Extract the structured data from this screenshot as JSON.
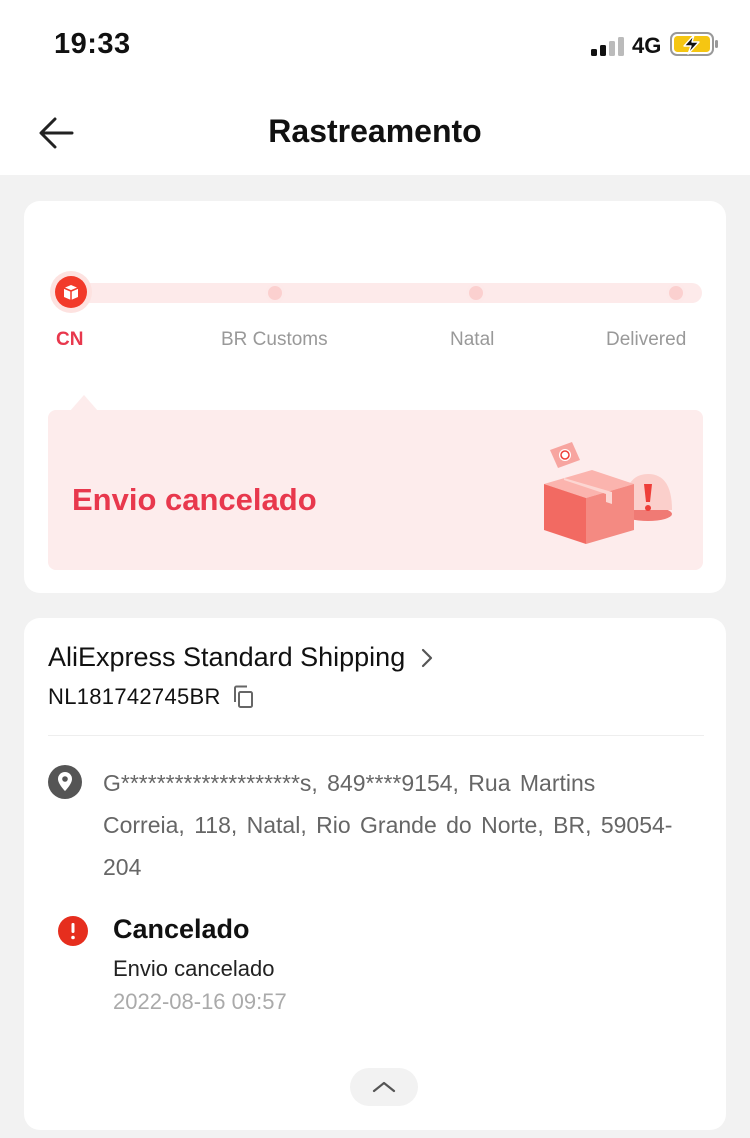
{
  "status_bar": {
    "time": "19:33",
    "network": "4G",
    "signal_icon": "signal-bars-icon",
    "battery_icon": "battery-charging-icon"
  },
  "header": {
    "title": "Rastreamento",
    "back_icon": "arrow-left-icon"
  },
  "progress": {
    "steps": [
      {
        "label": "CN",
        "active": true
      },
      {
        "label": "BR Customs",
        "active": false
      },
      {
        "label": "Natal",
        "active": false
      },
      {
        "label": "Delivered",
        "active": false
      }
    ],
    "notice": "Envio cancelado",
    "illustration_icon": "cancelled-package-icon"
  },
  "shipping": {
    "carrier": "AliExpress Standard Shipping",
    "tracking_number": "NL181742745BR",
    "copy_icon": "copy-icon",
    "address": "G********************s,  849****9154,  Rua Martins Correia, 118,  Natal,  Rio Grande do Norte,  BR,  59054-204",
    "event": {
      "title": "Cancelado",
      "description": "Envio cancelado",
      "timestamp": "2022-08-16 09:57"
    }
  },
  "colors": {
    "accent": "#e8384d",
    "alert": "#e62e1e",
    "notice_bg": "#fdecec"
  }
}
